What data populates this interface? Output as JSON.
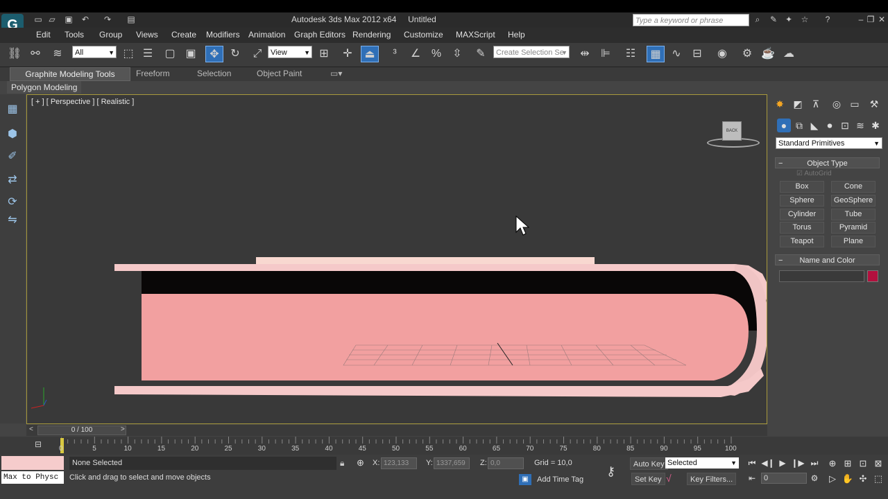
{
  "window": {
    "app_title": "Autodesk 3ds Max  2012 x64",
    "doc_title": "Untitled",
    "search_placeholder": "Type a keyword or phrase"
  },
  "menu": [
    "Edit",
    "Tools",
    "Group",
    "Views",
    "Create",
    "Modifiers",
    "Animation",
    "Graph Editors",
    "Rendering",
    "Customize",
    "MAXScript",
    "Help"
  ],
  "toolbar": {
    "filter_value": "All",
    "ref_coord_value": "View",
    "selection_set_placeholder": "Create Selection Se"
  },
  "ribbon": {
    "tabs": [
      "Graphite Modeling Tools",
      "Freeform",
      "Selection",
      "Object Paint"
    ],
    "active_tab": "Graphite Modeling Tools",
    "subpanel": "Polygon Modeling"
  },
  "viewport": {
    "label": "[ + ] [ Perspective ] [ Realistic ]",
    "viewcube_face": "BACK",
    "object_color": "#f3a3a3"
  },
  "command_panel": {
    "category_dropdown": "Standard Primitives",
    "object_type_header": "Object Type",
    "autogrid_label": "AutoGrid",
    "primitives": [
      "Box",
      "Cone",
      "Sphere",
      "GeoSphere",
      "Cylinder",
      "Tube",
      "Torus",
      "Pyramid",
      "Teapot",
      "Plane"
    ],
    "name_color_header": "Name and Color",
    "object_color_swatch": "#b3103e"
  },
  "timeline": {
    "frame_display": "0 / 100",
    "ticks": [
      "0",
      "5",
      "10",
      "15",
      "20",
      "25",
      "30",
      "35",
      "40",
      "45",
      "50",
      "55",
      "60",
      "65",
      "70",
      "75",
      "80",
      "85",
      "90",
      "95",
      "100"
    ]
  },
  "status": {
    "listener_text": "Max to Physc",
    "selection_text": "None Selected",
    "prompt_text": "Click and drag to select and move objects",
    "x_label": "X:",
    "x_value": "123,133",
    "y_label": "Y:",
    "y_value": "1337,659",
    "z_label": "Z:",
    "z_value": "0,0",
    "grid_text": "Grid = 10,0",
    "add_time_tag": "Add Time Tag",
    "auto_key": "Auto Key",
    "set_key": "Set Key",
    "key_mode_value": "Selected",
    "key_filters": "Key Filters...",
    "current_frame": "0"
  }
}
